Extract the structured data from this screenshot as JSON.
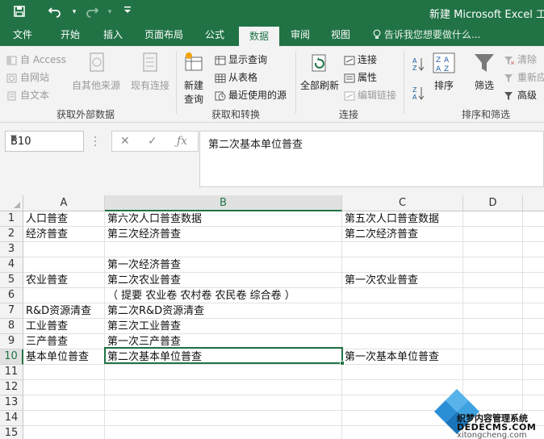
{
  "window": {
    "title": "新建 Microsoft Excel 工作",
    "accent": "#217346"
  },
  "quick_access": {
    "icons": [
      "save-icon",
      "undo-icon",
      "redo-icon",
      "customize-icon"
    ]
  },
  "tabs": [
    {
      "label": "文件"
    },
    {
      "label": "开始"
    },
    {
      "label": "插入"
    },
    {
      "label": "页面布局"
    },
    {
      "label": "公式"
    },
    {
      "label": "数据",
      "active": true
    },
    {
      "label": "审阅"
    },
    {
      "label": "视图"
    }
  ],
  "tell_me": "告诉我您想要做什么...",
  "ribbon": {
    "external": {
      "access": "自 Access",
      "web": "自网站",
      "text": "自文本",
      "other": "自其他来源",
      "existing": "现有连接",
      "group": "获取外部数据"
    },
    "transform": {
      "new_query_1": "新建",
      "new_query_2": "查询",
      "show_queries": "显示查询",
      "from_table": "从表格",
      "recent_sources": "最近使用的源",
      "group": "获取和转换"
    },
    "connections": {
      "refresh_all": "全部刷新",
      "connections": "连接",
      "properties": "属性",
      "edit_links": "编辑链接",
      "group": "连接"
    },
    "sort_filter": {
      "sort": "排序",
      "filter": "筛选",
      "clear": "清除",
      "reapply": "重新应",
      "advanced": "高级",
      "group": "排序和筛选"
    }
  },
  "formula_bar": {
    "name_box": "B10",
    "formula": "第二次基本单位普查"
  },
  "sheet": {
    "columns": [
      "A",
      "B",
      "C",
      "D"
    ],
    "rows": [
      "1",
      "2",
      "3",
      "4",
      "5",
      "6",
      "7",
      "8",
      "9",
      "10",
      "11",
      "12",
      "13",
      "14",
      "15"
    ],
    "cells": {
      "r1": {
        "a": "人口普查",
        "b": "第六次人口普查数据",
        "c": "第五次人口普查数据"
      },
      "r2": {
        "a": "经济普查",
        "b": "第三次经济普查",
        "c": "第二次经济普查"
      },
      "r4": {
        "b": "第一次经济普查"
      },
      "r5": {
        "a": "农业普查",
        "b": "第二次农业普查",
        "c": "第一次农业普查"
      },
      "r6": {
        "b": "（ 提要 农业卷 农村卷 农民卷 综合卷 ）"
      },
      "r7": {
        "a": "R&D资源清查",
        "b": "第二次R&D资源清查"
      },
      "r8": {
        "a": "工业普查",
        "b": "第三次工业普查"
      },
      "r9": {
        "a": "三产普查",
        "b": "第一次三产普查"
      },
      "r10": {
        "a": "基本单位普查",
        "b": "第二次基本单位普查",
        "c": "第一次基本单位普查"
      }
    }
  },
  "watermark": {
    "line1": "织梦内容管理系统",
    "line2": "DEDECMS.COM",
    "line3": "xitongcheng.com"
  }
}
